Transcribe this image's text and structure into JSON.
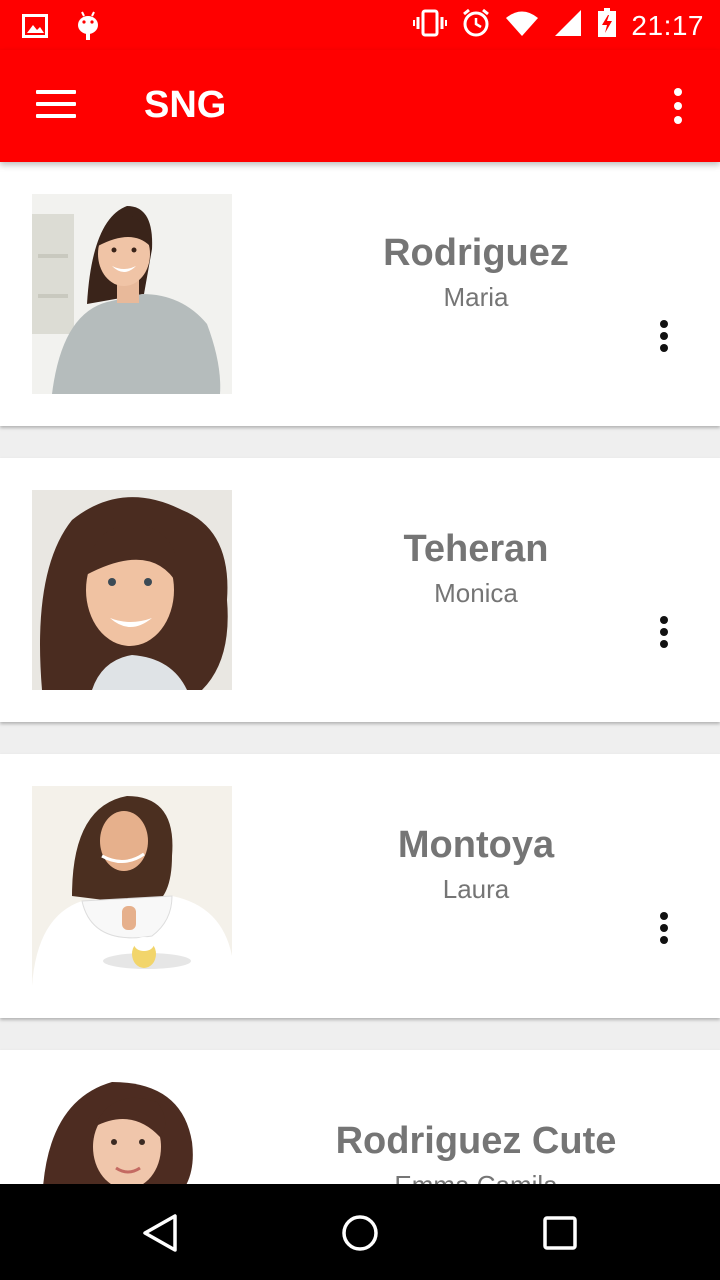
{
  "status_bar": {
    "time": "21:17",
    "left_icons": [
      "image-notification-icon",
      "android-debug-icon"
    ],
    "right_icons": [
      "vibrate-icon",
      "alarm-icon",
      "wifi-icon",
      "signal-icon",
      "battery-charging-icon"
    ]
  },
  "app_bar": {
    "title": "SNG",
    "background": "#ff0000"
  },
  "contacts": [
    {
      "surname": "Rodriguez",
      "first_name": "Maria"
    },
    {
      "surname": "Teheran",
      "first_name": "Monica"
    },
    {
      "surname": "Montoya",
      "first_name": "Laura"
    },
    {
      "surname": "Rodriguez Cute",
      "first_name": "Emma Camila"
    }
  ],
  "nav_bar": {
    "buttons": [
      "back-icon",
      "home-icon",
      "recents-icon"
    ]
  }
}
